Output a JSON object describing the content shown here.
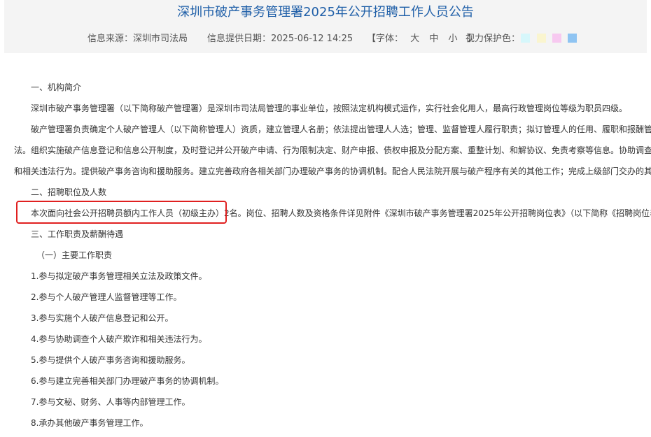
{
  "header": {
    "title": "深圳市破产事务管理署2025年公开招聘工作人员公告",
    "source_label": "信息来源：深圳市司法局",
    "date_label": "信息提供日期：2025-06-12 14:25",
    "font_open": "【字体：",
    "font_sizes": [
      "大",
      "中",
      "小"
    ],
    "font_close": "】",
    "vision_label": "视力保护色：",
    "vision_colors": [
      "#d6f7fb",
      "#faf5cf",
      "#f7c9f0",
      "#8fc4f2"
    ]
  },
  "content": {
    "lines": [
      "一、机构简介",
      "深圳市破产事务管理署（以下简称破产管理署）是深圳市司法局管理的事业单位，按照法定机构模式运作，实行社会化用人，最高行政管理岗位等级为职员四级。",
      "破产管理署负责确定个人破产管理人（以下简称管理人）资质，建立管理人名册；依法提出管理人人选；管理、监督管理人履行职责；拟订管理人的任用、履职和报酬管理具体办",
      "法。组织实施破产信息登记和信息公开制度，及时登记并公开破产申请、行为限制决定、财产申报、债权申报及分配方案、重整计划、和解协议、免责考察等信息。协助调查破产欺诈",
      "和相关违法行为。提供破产事务咨询和援助服务。建立完善政府各相关部门办理破产事务的协调机制。配合人民法院开展与破产程序有关的其他工作；完成上级部门交办的其他任务。",
      "二、招聘职位及人数",
      "本次面向社会公开招聘员额内工作人员（初级主办）2名。岗位、招聘人数及资格条件详见附件《深圳市破产事务管理署2025年公开招聘岗位表》（以下简称《招聘岗位表》）。",
      "三、工作职责及薪酬待遇",
      "（一）主要工作职责",
      "1.参与拟定破产事务管理相关立法及政策文件。",
      "2.参与个人破产管理人监督管理等工作。",
      "3.参与实施个人破产信息登记和公开。",
      "4.参与协助调查个人破产欺诈和相关违法行为。",
      "5.参与提供个人破产事务咨询和援助服务。",
      "6.参与建立完善相关部门办理破产事务的协调机制。",
      "7.参与文秘、财务、人事等内部管理工作。",
      "8.承办其他破产事务管理工作。"
    ]
  },
  "highlight": {
    "color": "#e02020"
  }
}
